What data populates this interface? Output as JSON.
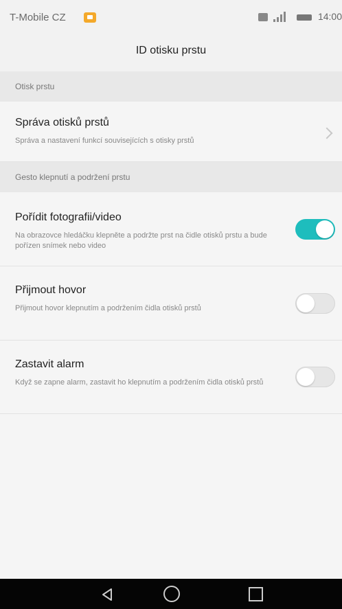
{
  "status_bar": {
    "carrier": "T-Mobile CZ",
    "time": "14:00"
  },
  "header": {
    "title": "ID otisku prstu"
  },
  "sections": [
    {
      "header": "Otisk prstu",
      "items": [
        {
          "title": "Správa otisků prstů",
          "subtitle": "Správa a nastavení funkcí souvisejících s otisky prstů",
          "control": "chevron"
        }
      ]
    },
    {
      "header": "Gesto klepnutí a podržení prstu",
      "items": [
        {
          "title": "Pořídit fotografii/video",
          "subtitle": "Na obrazovce hledáčku klepněte a podržte prst na čidle otisků prstu a bude pořízen snímek nebo video",
          "control": "toggle",
          "checked": true
        },
        {
          "title": "Přijmout hovor",
          "subtitle": "Přijmout hovor klepnutím a podržením čidla otisků prstů",
          "control": "toggle",
          "checked": false
        },
        {
          "title": "Zastavit alarm",
          "subtitle": "Když se zapne alarm, zastavit ho klepnutím a podržením čidla otisků prstů",
          "control": "toggle",
          "checked": false
        }
      ]
    }
  ],
  "colors": {
    "accent": "#1ebdbd",
    "background": "#f2f2f2",
    "navbar": "#050505"
  },
  "icons": [
    "carrier-notification-icon",
    "sim-icon",
    "signal-icon",
    "battery-icon",
    "chevron-right-icon",
    "back-icon",
    "home-icon",
    "recent-apps-icon"
  ]
}
